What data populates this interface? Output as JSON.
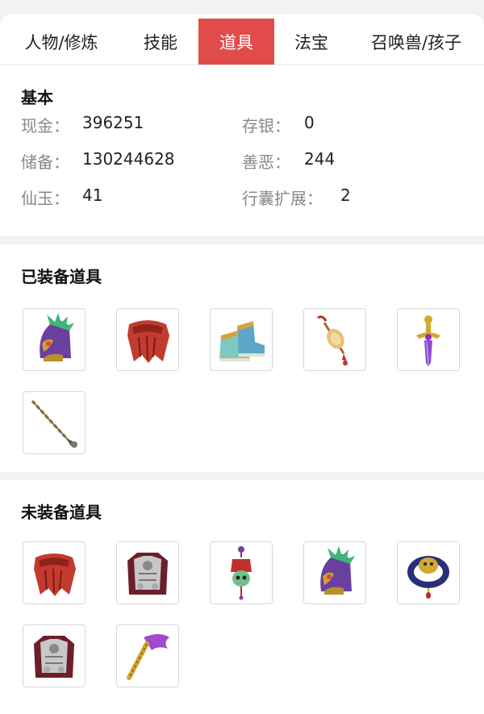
{
  "tabs": [
    {
      "label": "人物/修炼"
    },
    {
      "label": "技能"
    },
    {
      "label": "道具"
    },
    {
      "label": "法宝"
    },
    {
      "label": "召唤兽/孩子"
    }
  ],
  "active_tab_index": 2,
  "basic": {
    "title": "基本",
    "fields": [
      {
        "label": "现金：",
        "value": "396251"
      },
      {
        "label": "存银：",
        "value": "0"
      },
      {
        "label": "储备：",
        "value": "130244628"
      },
      {
        "label": "善恶：",
        "value": "244"
      },
      {
        "label": "仙玉：",
        "value": "41"
      },
      {
        "label": "行囊扩展：",
        "value": "2"
      }
    ]
  },
  "equipped": {
    "title": "已装备道具",
    "items": [
      {
        "icon": "spiked-helmet-icon"
      },
      {
        "icon": "red-cape-icon"
      },
      {
        "icon": "ornate-boots-icon"
      },
      {
        "icon": "jade-amulet-icon"
      },
      {
        "icon": "purple-sword-hilt-icon"
      },
      {
        "icon": "chain-whip-icon"
      }
    ]
  },
  "unequipped": {
    "title": "未装备道具",
    "items": [
      {
        "icon": "red-cape-icon"
      },
      {
        "icon": "silver-armor-icon"
      },
      {
        "icon": "skull-pendant-icon"
      },
      {
        "icon": "spiked-helmet-icon"
      },
      {
        "icon": "dragon-ring-icon"
      },
      {
        "icon": "silver-armor-icon"
      },
      {
        "icon": "purple-ribbon-icon"
      }
    ]
  },
  "colors": {
    "accent": "#e14c4a",
    "background": "#f2f2f2"
  }
}
